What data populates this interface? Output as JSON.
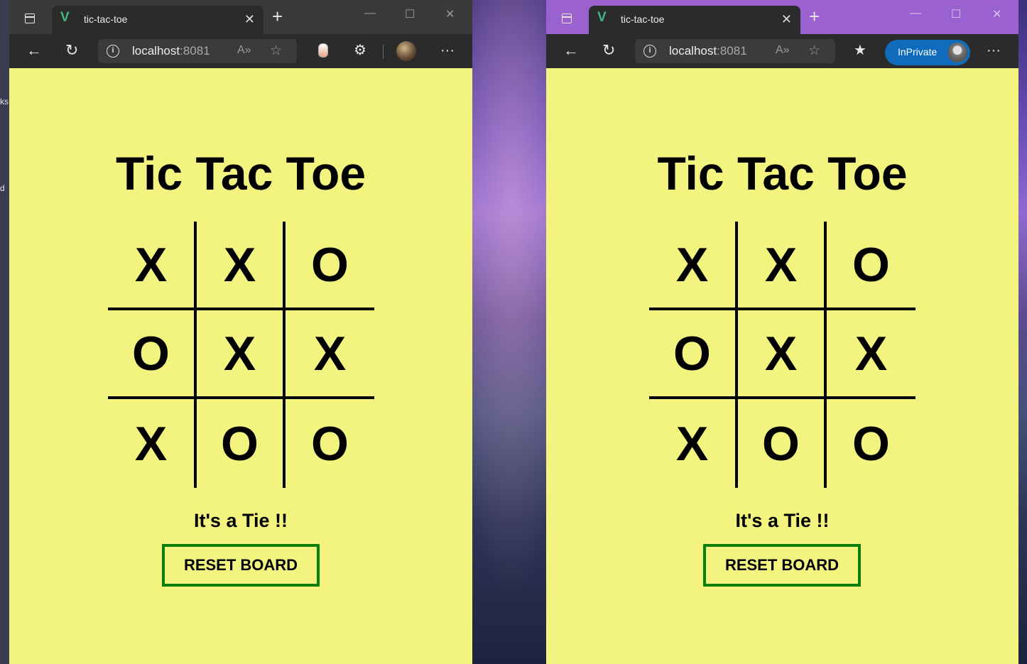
{
  "desktop": {
    "edge_letters": [
      "ks",
      "d"
    ]
  },
  "browsers": {
    "left": {
      "tab": {
        "title": "tic-tac-toe",
        "favicon": "V",
        "close": "✕"
      },
      "new_tab": "+",
      "window_controls": {
        "minimize": "—",
        "maximize": "☐",
        "close": "✕"
      },
      "address": {
        "host": "localhost",
        "port": ":8081"
      },
      "read_aloud": "A»",
      "more": "···"
    },
    "right": {
      "tab": {
        "title": "tic-tac-toe",
        "favicon": "V",
        "close": "✕"
      },
      "new_tab": "+",
      "window_controls": {
        "minimize": "—",
        "maximize": "☐",
        "close": "✕"
      },
      "address": {
        "host": "localhost",
        "port": ":8081"
      },
      "read_aloud": "A»",
      "inprivate_label": "InPrivate",
      "more": "···"
    }
  },
  "game": {
    "title": "Tic Tac Toe",
    "board": [
      [
        "X",
        "X",
        "O"
      ],
      [
        "O",
        "X",
        "X"
      ],
      [
        "X",
        "O",
        "O"
      ]
    ],
    "status": "It's a Tie !!",
    "reset_label": "RESET BOARD"
  },
  "colors": {
    "page_background": "#f2f47f",
    "reset_border": "#0b7d0b",
    "inprivate": "#0f6cbd",
    "vue_green": "#42b883"
  }
}
